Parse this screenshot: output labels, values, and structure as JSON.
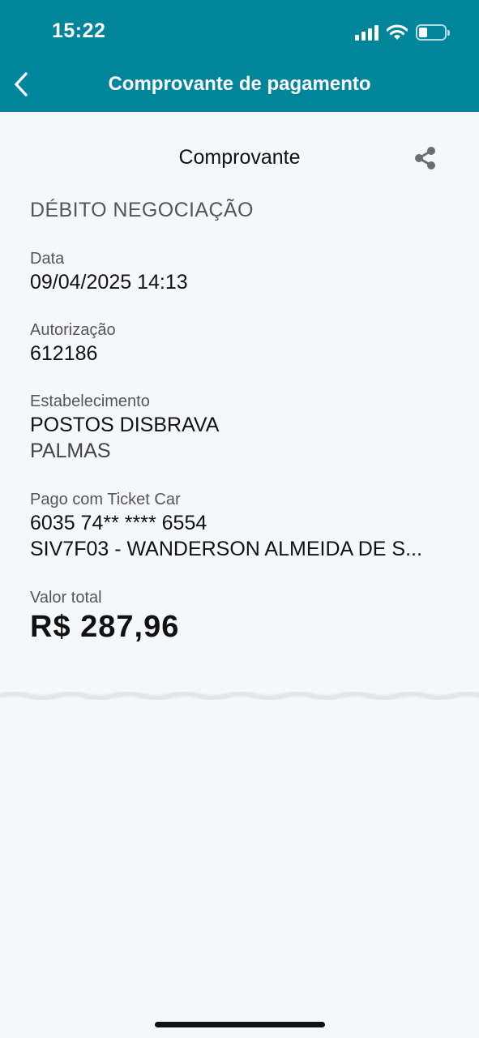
{
  "status_bar": {
    "time": "15:22",
    "battery_level": 0.28,
    "icons": [
      "signal-icon",
      "wifi-icon",
      "battery-icon"
    ]
  },
  "header": {
    "title": "Comprovante de pagamento",
    "back_icon": "chevron-left-icon",
    "background_color": "#00859a"
  },
  "receipt": {
    "title": "Comprovante",
    "share_icon": "share-icon",
    "type": "DÉBITO NEGOCIAÇÃO",
    "date_label": "Data",
    "date_value": "09/04/2025 14:13",
    "authorization_label": "Autorização",
    "authorization_value": "612186",
    "establishment_label": "Estabelecimento",
    "establishment_name": "POSTOS DISBRAVA",
    "establishment_city": "PALMAS",
    "paid_with_label": "Pago com Ticket Car",
    "card_number": "6035 74** **** 6554",
    "card_holder": "SIV7F03 - WANDERSON ALMEIDA DE S...",
    "total_label": "Valor total",
    "total_value": "R$ 287,96"
  }
}
